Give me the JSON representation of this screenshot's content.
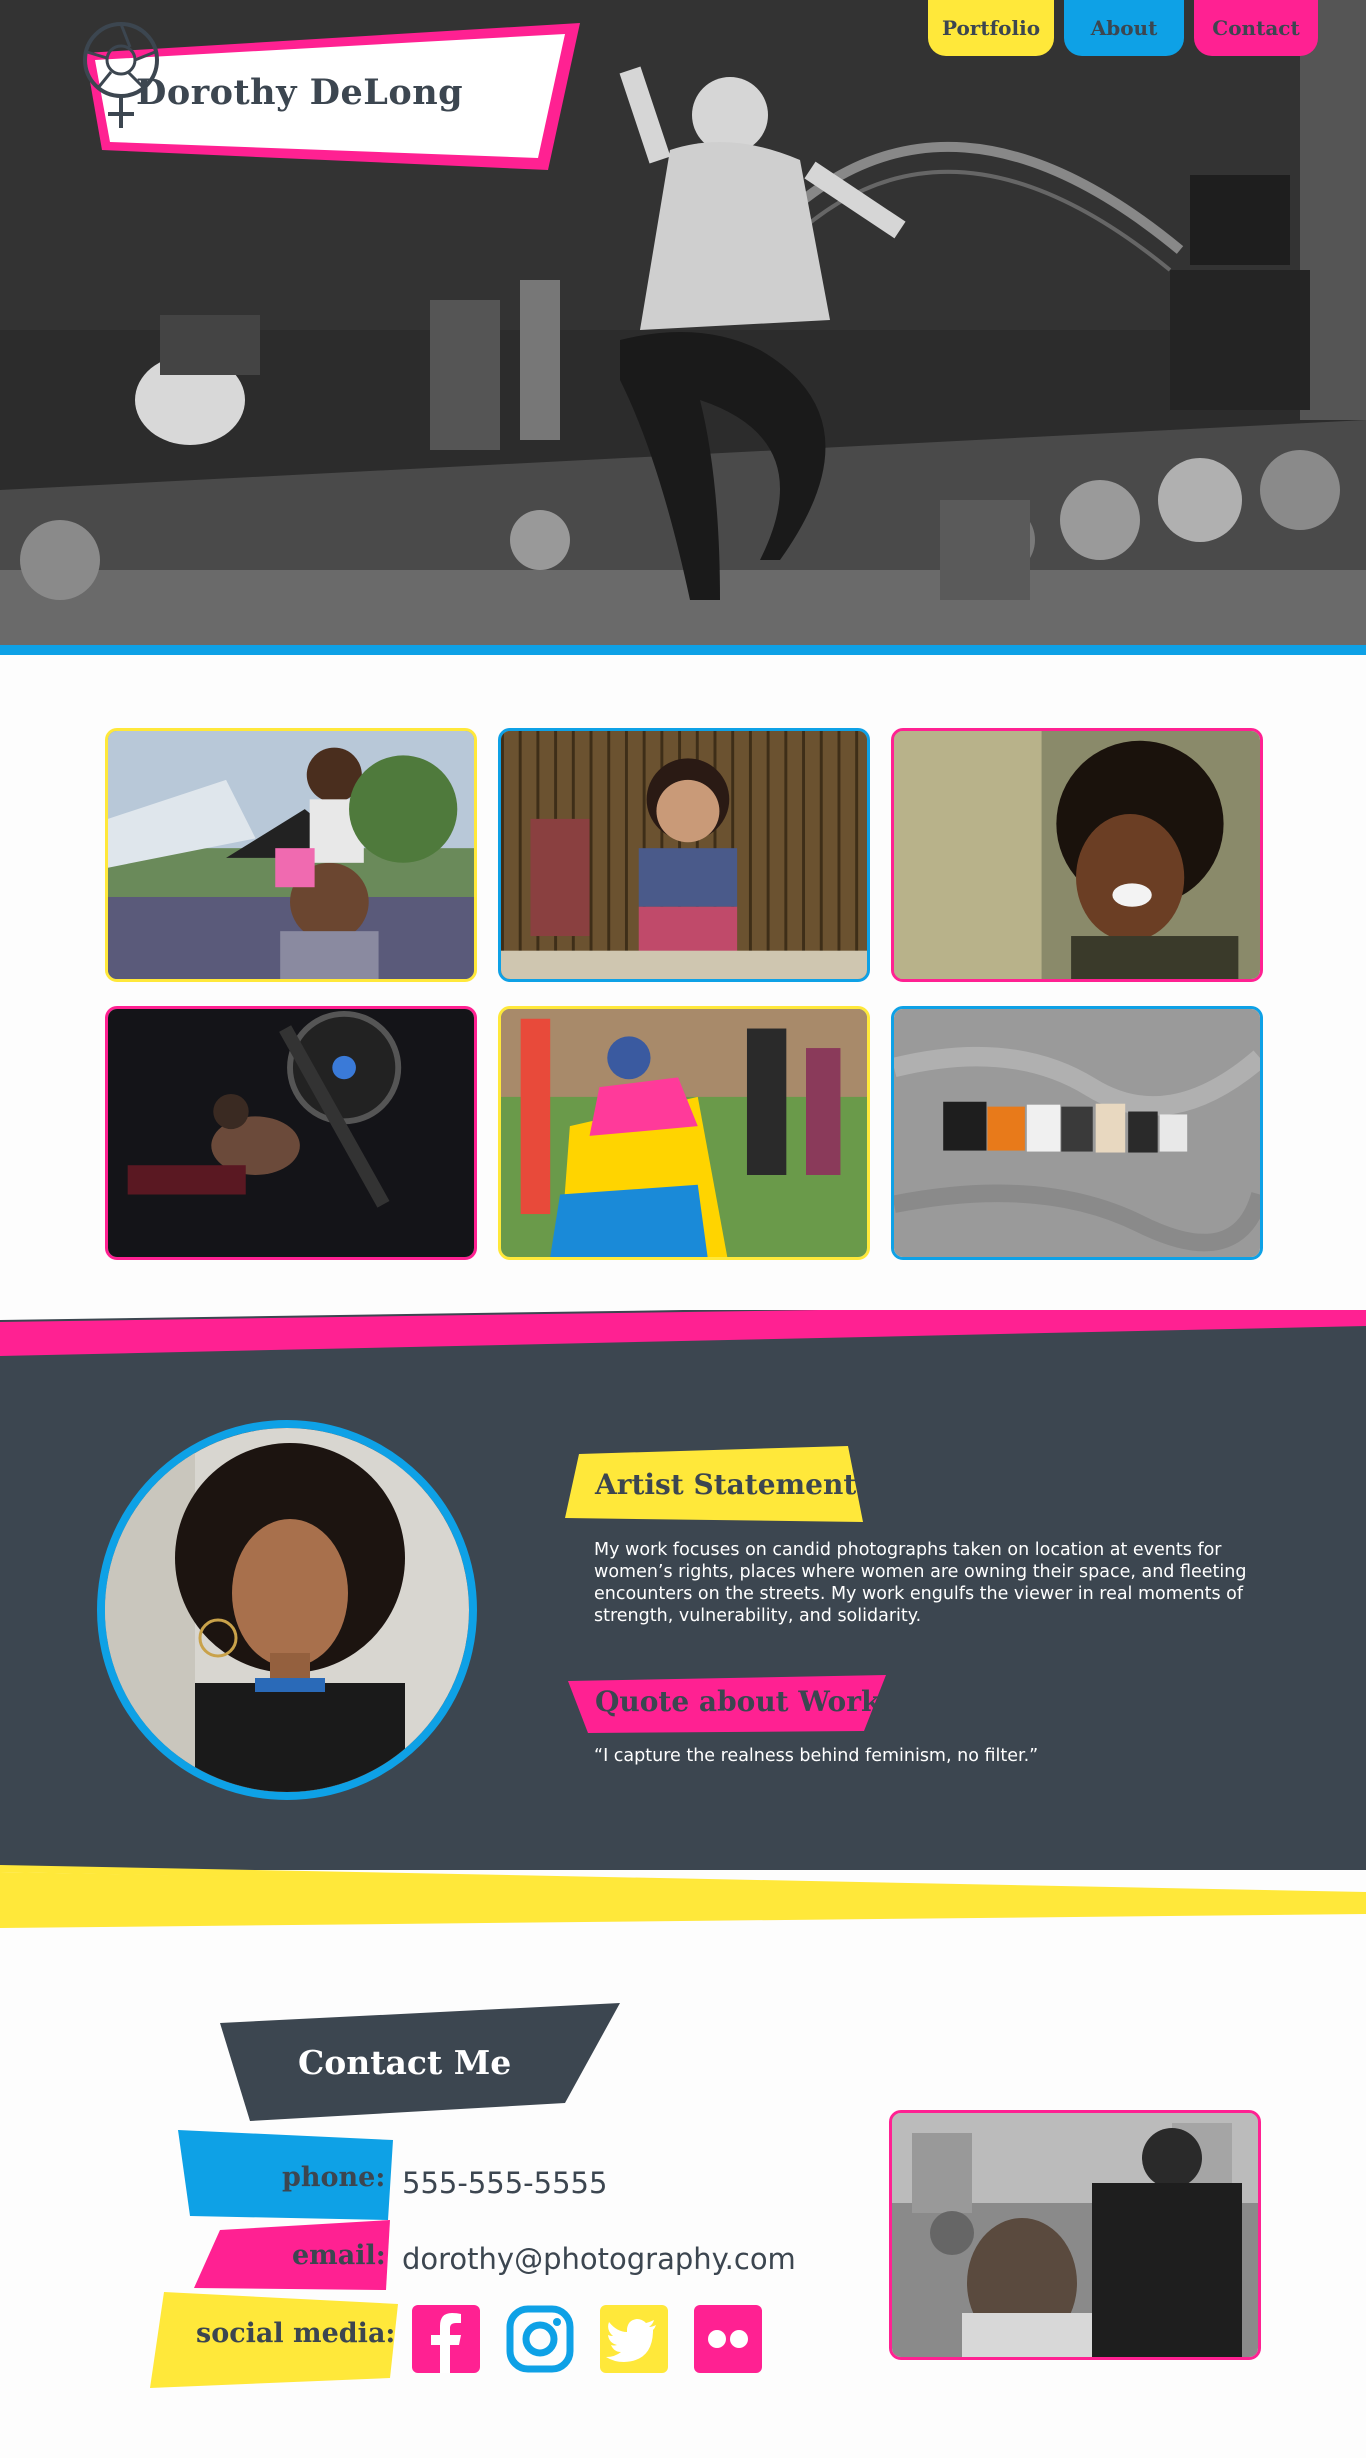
{
  "site": {
    "name": "Dorothy DeLong",
    "logo_icon": "camera-aperture-venus-icon"
  },
  "nav": {
    "items": [
      {
        "label": "Portfolio",
        "color": "#ffe83a"
      },
      {
        "label": "About",
        "color": "#0ea1e6"
      },
      {
        "label": "Contact",
        "color": "#ff2192"
      }
    ]
  },
  "colors": {
    "yellow": "#ffe83a",
    "blue": "#0ea1e6",
    "pink": "#ff2192",
    "slate": "#3c4650",
    "white": "#ffffff"
  },
  "gallery": {
    "tiles": [
      {
        "subject": "father with daughter on shoulders at festival",
        "border": "#ffe83a"
      },
      {
        "subject": "smiling child in colorful dress",
        "border": "#0ea1e6"
      },
      {
        "subject": "laughing woman with headphones",
        "border": "#ff2192"
      },
      {
        "subject": "woman training at gym machine",
        "border": "#ff2192"
      },
      {
        "subject": "person with pride flag at parade",
        "border": "#ffe83a"
      },
      {
        "subject": "#MeToo letters on wall",
        "border": "#0ea1e6"
      }
    ]
  },
  "about": {
    "statement_heading": "Artist Statement",
    "statement_text": "My work focuses on candid photographs taken on location at events for women’s rights, places where women are owning their space, and fleeting encounters on the streets. My work engulfs the viewer in real moments of strength, vulnerability, and solidarity.",
    "quote_heading": "Quote about Work",
    "quote_text": "“I capture the realness behind feminism, no filter.”"
  },
  "contact": {
    "heading": "Contact Me",
    "phone_label": "phone:",
    "phone": "555-555-5555",
    "email_label": "email:",
    "email": "dorothy@photography.com",
    "social_label": "social media:",
    "social": [
      {
        "name": "facebook-icon",
        "color": "#ff2192"
      },
      {
        "name": "instagram-icon",
        "color": "#0ea1e6"
      },
      {
        "name": "twitter-icon",
        "color": "#ffe83a"
      },
      {
        "name": "flickr-icon",
        "color": "#ff2192"
      }
    ]
  }
}
